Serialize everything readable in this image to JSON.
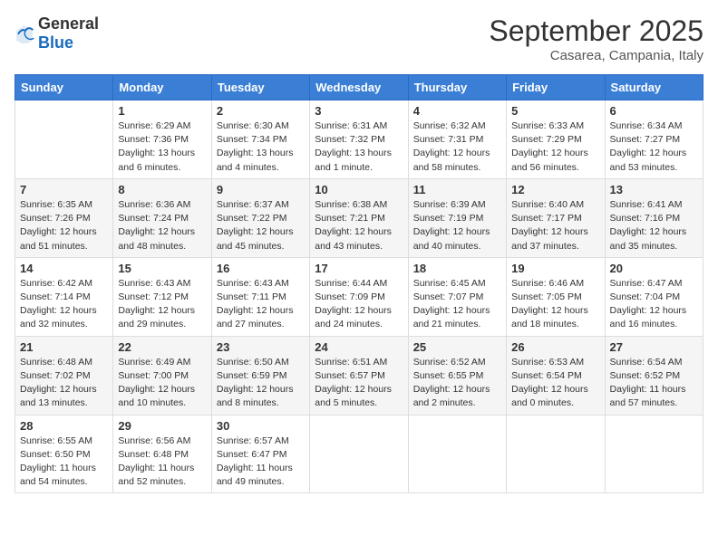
{
  "header": {
    "logo": {
      "general": "General",
      "blue": "Blue"
    },
    "month": "September 2025",
    "location": "Casarea, Campania, Italy"
  },
  "weekdays": [
    "Sunday",
    "Monday",
    "Tuesday",
    "Wednesday",
    "Thursday",
    "Friday",
    "Saturday"
  ],
  "weeks": [
    [
      {
        "day": "",
        "sunrise": "",
        "sunset": "",
        "daylight": ""
      },
      {
        "day": "1",
        "sunrise": "Sunrise: 6:29 AM",
        "sunset": "Sunset: 7:36 PM",
        "daylight": "Daylight: 13 hours and 6 minutes."
      },
      {
        "day": "2",
        "sunrise": "Sunrise: 6:30 AM",
        "sunset": "Sunset: 7:34 PM",
        "daylight": "Daylight: 13 hours and 4 minutes."
      },
      {
        "day": "3",
        "sunrise": "Sunrise: 6:31 AM",
        "sunset": "Sunset: 7:32 PM",
        "daylight": "Daylight: 13 hours and 1 minute."
      },
      {
        "day": "4",
        "sunrise": "Sunrise: 6:32 AM",
        "sunset": "Sunset: 7:31 PM",
        "daylight": "Daylight: 12 hours and 58 minutes."
      },
      {
        "day": "5",
        "sunrise": "Sunrise: 6:33 AM",
        "sunset": "Sunset: 7:29 PM",
        "daylight": "Daylight: 12 hours and 56 minutes."
      },
      {
        "day": "6",
        "sunrise": "Sunrise: 6:34 AM",
        "sunset": "Sunset: 7:27 PM",
        "daylight": "Daylight: 12 hours and 53 minutes."
      }
    ],
    [
      {
        "day": "7",
        "sunrise": "Sunrise: 6:35 AM",
        "sunset": "Sunset: 7:26 PM",
        "daylight": "Daylight: 12 hours and 51 minutes."
      },
      {
        "day": "8",
        "sunrise": "Sunrise: 6:36 AM",
        "sunset": "Sunset: 7:24 PM",
        "daylight": "Daylight: 12 hours and 48 minutes."
      },
      {
        "day": "9",
        "sunrise": "Sunrise: 6:37 AM",
        "sunset": "Sunset: 7:22 PM",
        "daylight": "Daylight: 12 hours and 45 minutes."
      },
      {
        "day": "10",
        "sunrise": "Sunrise: 6:38 AM",
        "sunset": "Sunset: 7:21 PM",
        "daylight": "Daylight: 12 hours and 43 minutes."
      },
      {
        "day": "11",
        "sunrise": "Sunrise: 6:39 AM",
        "sunset": "Sunset: 7:19 PM",
        "daylight": "Daylight: 12 hours and 40 minutes."
      },
      {
        "day": "12",
        "sunrise": "Sunrise: 6:40 AM",
        "sunset": "Sunset: 7:17 PM",
        "daylight": "Daylight: 12 hours and 37 minutes."
      },
      {
        "day": "13",
        "sunrise": "Sunrise: 6:41 AM",
        "sunset": "Sunset: 7:16 PM",
        "daylight": "Daylight: 12 hours and 35 minutes."
      }
    ],
    [
      {
        "day": "14",
        "sunrise": "Sunrise: 6:42 AM",
        "sunset": "Sunset: 7:14 PM",
        "daylight": "Daylight: 12 hours and 32 minutes."
      },
      {
        "day": "15",
        "sunrise": "Sunrise: 6:43 AM",
        "sunset": "Sunset: 7:12 PM",
        "daylight": "Daylight: 12 hours and 29 minutes."
      },
      {
        "day": "16",
        "sunrise": "Sunrise: 6:43 AM",
        "sunset": "Sunset: 7:11 PM",
        "daylight": "Daylight: 12 hours and 27 minutes."
      },
      {
        "day": "17",
        "sunrise": "Sunrise: 6:44 AM",
        "sunset": "Sunset: 7:09 PM",
        "daylight": "Daylight: 12 hours and 24 minutes."
      },
      {
        "day": "18",
        "sunrise": "Sunrise: 6:45 AM",
        "sunset": "Sunset: 7:07 PM",
        "daylight": "Daylight: 12 hours and 21 minutes."
      },
      {
        "day": "19",
        "sunrise": "Sunrise: 6:46 AM",
        "sunset": "Sunset: 7:05 PM",
        "daylight": "Daylight: 12 hours and 18 minutes."
      },
      {
        "day": "20",
        "sunrise": "Sunrise: 6:47 AM",
        "sunset": "Sunset: 7:04 PM",
        "daylight": "Daylight: 12 hours and 16 minutes."
      }
    ],
    [
      {
        "day": "21",
        "sunrise": "Sunrise: 6:48 AM",
        "sunset": "Sunset: 7:02 PM",
        "daylight": "Daylight: 12 hours and 13 minutes."
      },
      {
        "day": "22",
        "sunrise": "Sunrise: 6:49 AM",
        "sunset": "Sunset: 7:00 PM",
        "daylight": "Daylight: 12 hours and 10 minutes."
      },
      {
        "day": "23",
        "sunrise": "Sunrise: 6:50 AM",
        "sunset": "Sunset: 6:59 PM",
        "daylight": "Daylight: 12 hours and 8 minutes."
      },
      {
        "day": "24",
        "sunrise": "Sunrise: 6:51 AM",
        "sunset": "Sunset: 6:57 PM",
        "daylight": "Daylight: 12 hours and 5 minutes."
      },
      {
        "day": "25",
        "sunrise": "Sunrise: 6:52 AM",
        "sunset": "Sunset: 6:55 PM",
        "daylight": "Daylight: 12 hours and 2 minutes."
      },
      {
        "day": "26",
        "sunrise": "Sunrise: 6:53 AM",
        "sunset": "Sunset: 6:54 PM",
        "daylight": "Daylight: 12 hours and 0 minutes."
      },
      {
        "day": "27",
        "sunrise": "Sunrise: 6:54 AM",
        "sunset": "Sunset: 6:52 PM",
        "daylight": "Daylight: 11 hours and 57 minutes."
      }
    ],
    [
      {
        "day": "28",
        "sunrise": "Sunrise: 6:55 AM",
        "sunset": "Sunset: 6:50 PM",
        "daylight": "Daylight: 11 hours and 54 minutes."
      },
      {
        "day": "29",
        "sunrise": "Sunrise: 6:56 AM",
        "sunset": "Sunset: 6:48 PM",
        "daylight": "Daylight: 11 hours and 52 minutes."
      },
      {
        "day": "30",
        "sunrise": "Sunrise: 6:57 AM",
        "sunset": "Sunset: 6:47 PM",
        "daylight": "Daylight: 11 hours and 49 minutes."
      },
      {
        "day": "",
        "sunrise": "",
        "sunset": "",
        "daylight": ""
      },
      {
        "day": "",
        "sunrise": "",
        "sunset": "",
        "daylight": ""
      },
      {
        "day": "",
        "sunrise": "",
        "sunset": "",
        "daylight": ""
      },
      {
        "day": "",
        "sunrise": "",
        "sunset": "",
        "daylight": ""
      }
    ]
  ]
}
